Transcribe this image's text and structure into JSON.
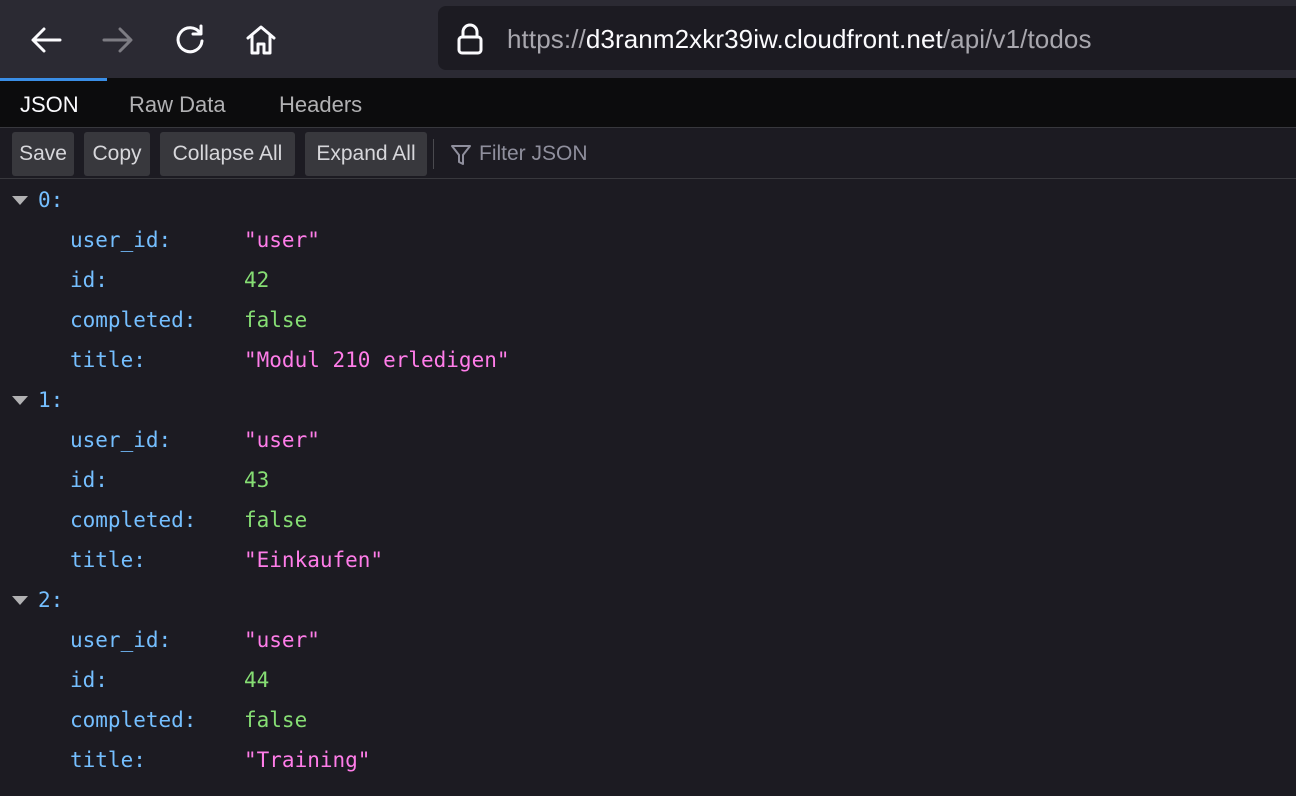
{
  "browser": {
    "url_scheme": "https://",
    "url_host": "d3ranm2xkr39iw.cloudfront.net",
    "url_path": "/api/v1/todos"
  },
  "tabs": [
    {
      "label": "JSON",
      "active": true
    },
    {
      "label": "Raw Data",
      "active": false
    },
    {
      "label": "Headers",
      "active": false
    }
  ],
  "toolbar": {
    "save_label": "Save",
    "copy_label": "Copy",
    "collapse_label": "Collapse All",
    "expand_label": "Expand All",
    "filter_placeholder": "Filter JSON"
  },
  "json": {
    "items": [
      {
        "index": "0:",
        "fields": [
          {
            "key": "user_id:",
            "value": "\"user\"",
            "type": "string"
          },
          {
            "key": "id:",
            "value": "42",
            "type": "number"
          },
          {
            "key": "completed:",
            "value": "false",
            "type": "boolean"
          },
          {
            "key": "title:",
            "value": "\"Modul 210 erledigen\"",
            "type": "string"
          }
        ]
      },
      {
        "index": "1:",
        "fields": [
          {
            "key": "user_id:",
            "value": "\"user\"",
            "type": "string"
          },
          {
            "key": "id:",
            "value": "43",
            "type": "number"
          },
          {
            "key": "completed:",
            "value": "false",
            "type": "boolean"
          },
          {
            "key": "title:",
            "value": "\"Einkaufen\"",
            "type": "string"
          }
        ]
      },
      {
        "index": "2:",
        "fields": [
          {
            "key": "user_id:",
            "value": "\"user\"",
            "type": "string"
          },
          {
            "key": "id:",
            "value": "44",
            "type": "number"
          },
          {
            "key": "completed:",
            "value": "false",
            "type": "boolean"
          },
          {
            "key": "title:",
            "value": "\"Training\"",
            "type": "string"
          }
        ]
      }
    ]
  },
  "colors": {
    "key": "#75bfff",
    "string": "#ff7de9",
    "number": "#86de74",
    "accent": "#3a8ee6"
  }
}
